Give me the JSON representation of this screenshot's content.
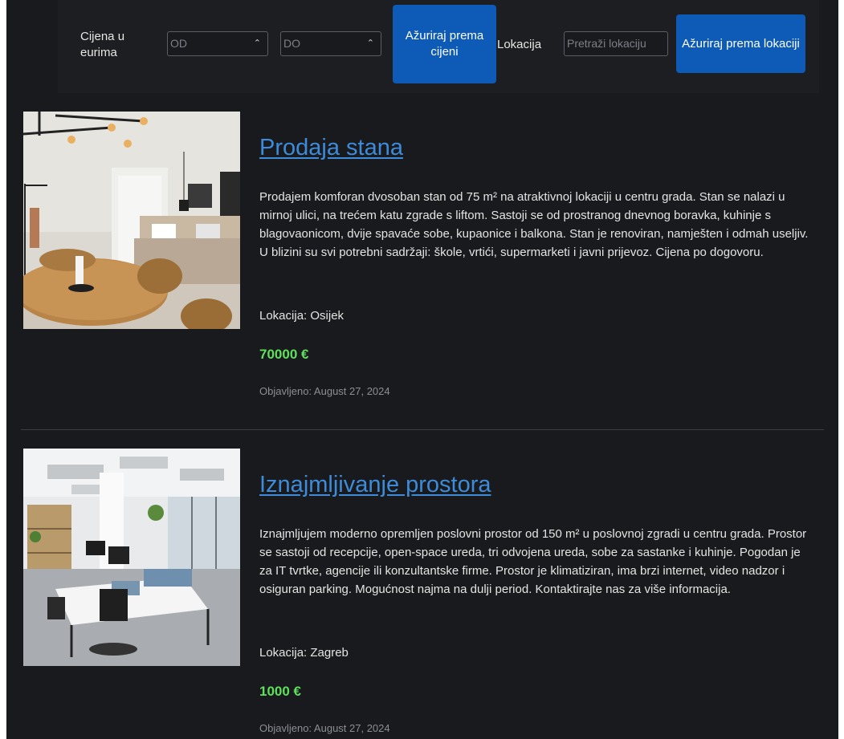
{
  "filter": {
    "price_label": "Cijena u eurima",
    "price_from_placeholder": "OD",
    "price_to_placeholder": "DO",
    "price_button": "Ažuriraj prema cijeni",
    "location_label": "Lokacija",
    "location_placeholder": "Pretraži lokaciju",
    "location_button": "Ažuriraj prema lokaciji"
  },
  "listings": [
    {
      "title": "Prodaja stana",
      "description": "Prodajem komforan dvosoban stan od 75 m² na atraktivnoj lokaciji u centru grada. Stan se nalazi u mirnoj ulici, na trećem katu zgrade s liftom. Sastoji se od prostranog dnevnog boravka, kuhinje s blagovaonicom, dvije spavaće sobe, kupaonice i balkona. Stan je renoviran, namješten i odmah useljiv. U blizini su svi potrebni sadržaji: škole, vrtići, supermarketi i javni prijevoz. Cijena po dogovoru.",
      "location": "Lokacija: Osijek",
      "price": "70000 €",
      "published": "Objavljeno: August 27, 2024",
      "image": "apartment-photo"
    },
    {
      "title": "Iznajmljivanje prostora",
      "description": "Iznajmljujem moderno opremljen poslovni prostor od 150 m² u poslovnoj zgradi u centru grada. Prostor se sastoji od recepcije, open-space ureda, tri odvojena ureda, sobe za sastanke i kuhinje. Pogodan je za IT tvrtke, agencije ili konzultantske firme. Prostor je klimatiziran, ima brzi internet, video nadzor i osiguran parking. Mogućnost najma na dulji period. Kontaktirajte nas za više informacija.",
      "location": "Lokacija: Zagreb",
      "price": "1000 €",
      "published": "Objavljeno: August 27, 2024",
      "image": "office-photo"
    }
  ],
  "colors": {
    "background": "#181a1d",
    "link": "#3d8bd9",
    "price": "#5fe05a",
    "button": "#0d5ab7"
  }
}
